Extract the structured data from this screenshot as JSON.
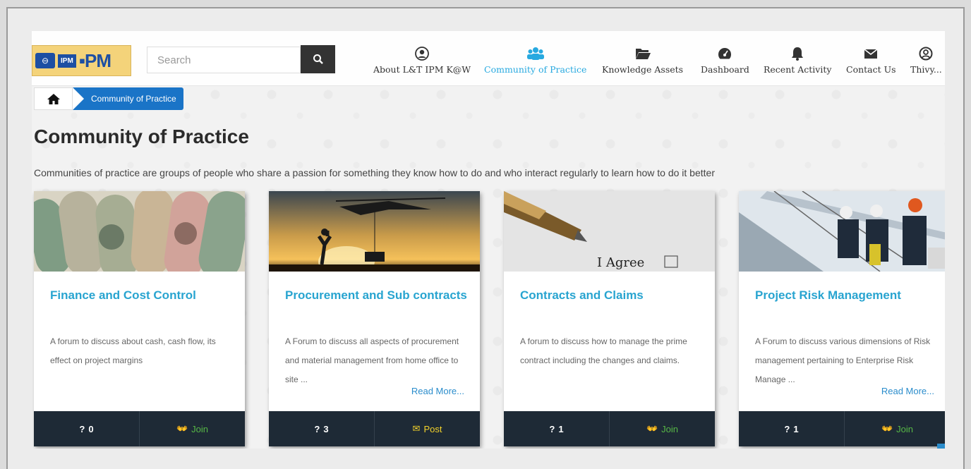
{
  "header": {
    "logo_text_ipm": "IPM",
    "logo_text_pm": "PM",
    "search_placeholder": "Search",
    "nav": [
      {
        "label": "About L&T IPM K@W",
        "icon": "user-circle-icon"
      },
      {
        "label": "Community of Practice",
        "icon": "users-icon",
        "active": true
      },
      {
        "label": "Knowledge Assets",
        "icon": "folder-open-icon"
      },
      {
        "label": "Dashboard",
        "icon": "dashboard-icon"
      },
      {
        "label": "Recent Activity",
        "icon": "bell-icon"
      },
      {
        "label": "Contact Us",
        "icon": "envelope-icon"
      },
      {
        "label": "Thivy...",
        "icon": "user-icon"
      }
    ]
  },
  "breadcrumb": {
    "current": "Community of Practice"
  },
  "page": {
    "title": "Community of Practice",
    "description": "Communities of practice are groups of people who share a passion for something  they know how to do and who interact regularly to learn how to do it better"
  },
  "cards": [
    {
      "title": "Finance and Cost Control",
      "text": "A forum to discuss about cash, cash flow, its effect on project margins",
      "read_more": "",
      "count": "0",
      "action": "Join"
    },
    {
      "title": "Procurement and Sub contracts",
      "text": "A Forum to discuss all aspects of procurement and material management from home office to site ...",
      "read_more": "Read More...",
      "count": "3",
      "action": "Post"
    },
    {
      "title": "Contracts and Claims",
      "text": "A forum to discuss how to manage the prime contract including the changes and claims.",
      "read_more": "",
      "count": "1",
      "action": "Join"
    },
    {
      "title": "Project Risk Management",
      "text": "A Forum to discuss various dimensions of Risk management pertaining to Enterprise Risk Manage ...",
      "read_more": "Read More...",
      "count": "1",
      "action": "Join"
    }
  ],
  "image_text": {
    "agree": "I Agree"
  },
  "colors": {
    "accent": "#27a9e0",
    "card_title": "#28a4d0",
    "footer": "#1e2a36",
    "join": "#57b846",
    "post": "#f3d22b",
    "breadcrumb": "#1a74c7"
  }
}
